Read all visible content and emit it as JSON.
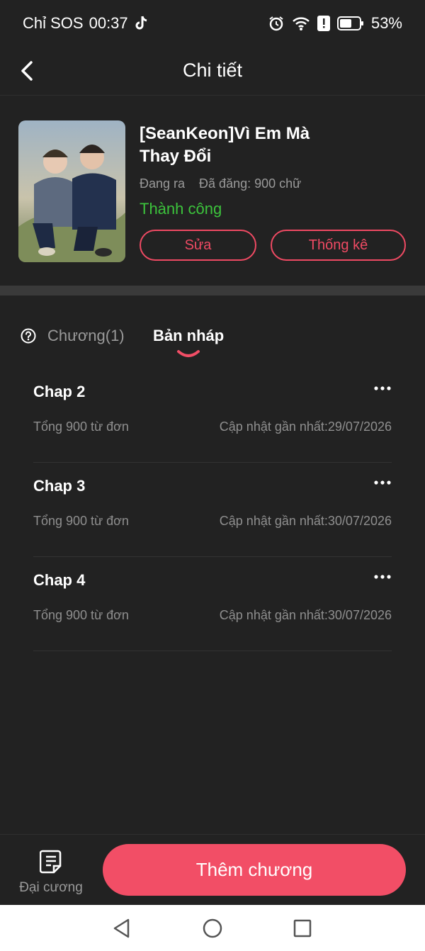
{
  "status_bar": {
    "carrier": "Chỉ SOS",
    "time": "00:37",
    "battery": "53%"
  },
  "header": {
    "title": "Chi tiết"
  },
  "book": {
    "title": "[SeanKeon]Vì Em Mà Thay Đổi",
    "state": "Đang ra",
    "posted": "Đã đăng: 900 chữ",
    "review_status": "Thành công",
    "edit_label": "Sửa",
    "stats_label": "Thống kê"
  },
  "tabs": {
    "chapters": "Chương(1)",
    "drafts": "Bản nháp"
  },
  "drafts": [
    {
      "title": "Chap 2",
      "words": "Tổng 900 từ đơn",
      "updated": "Cập nhật gần nhất:29/07/2026"
    },
    {
      "title": "Chap 3",
      "words": "Tổng 900 từ đơn",
      "updated": "Cập nhật gần nhất:30/07/2026"
    },
    {
      "title": "Chap 4",
      "words": "Tổng 900 từ đơn",
      "updated": "Cập nhật gần nhất:30/07/2026"
    }
  ],
  "bottom": {
    "outline_label": "Đại cương",
    "add_label": "Thêm chương"
  },
  "colors": {
    "accent": "#f24e66",
    "success": "#3cc33c",
    "background": "#222222"
  }
}
